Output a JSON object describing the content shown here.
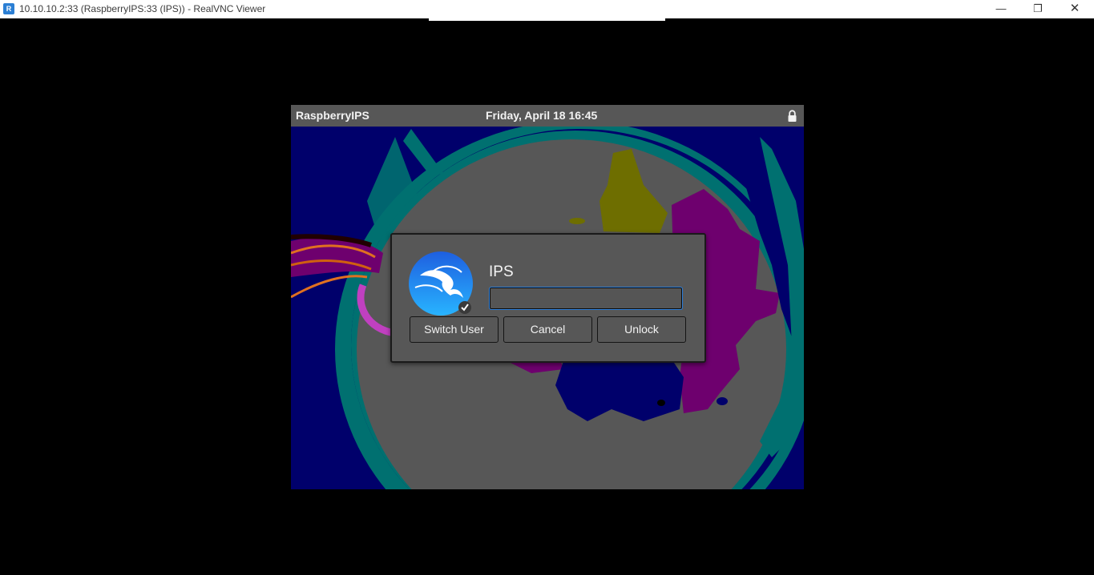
{
  "window": {
    "title": "10.10.10.2:33 (RaspberryIPS:33 (IPS)) - RealVNC Viewer",
    "app_icon_glyph": "R",
    "controls": {
      "minimize": "—",
      "maximize": "❐",
      "close": "✕"
    }
  },
  "remote": {
    "topbar": {
      "hostname": "RaspberryIPS",
      "datetime": "Friday, April 18  16:45",
      "lock_icon": "lock-icon"
    },
    "dialog": {
      "username": "IPS",
      "password_value": "",
      "avatar_icon": "kali-dragon-avatar-icon",
      "buttons": {
        "switch_user": "Switch User",
        "cancel": "Cancel",
        "unlock": "Unlock"
      }
    }
  },
  "colors": {
    "accent": "#2e7fd9",
    "panel": "#575757",
    "wallpaper_navy": "#00006b",
    "wallpaper_teal": "#007070",
    "wallpaper_purple": "#6e006e",
    "wallpaper_olive": "#6e6e00"
  }
}
